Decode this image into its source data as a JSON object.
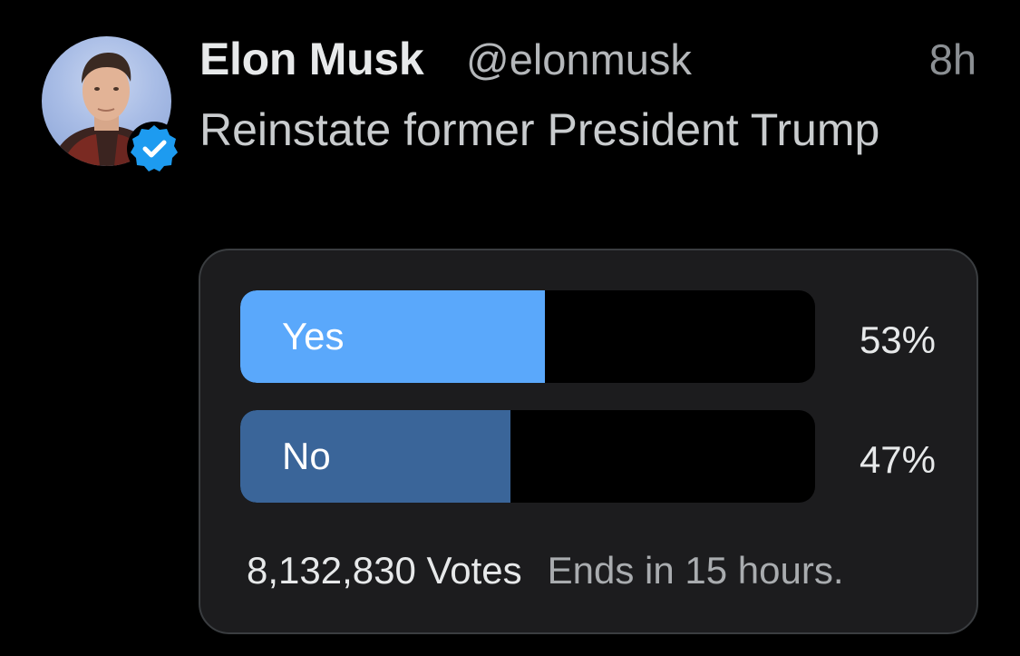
{
  "tweet": {
    "author_name": "Elon Musk",
    "author_handle": "@elonmusk",
    "timestamp": "8h",
    "text": "Reinstate former President Trump",
    "avatar_icon": "profile-photo",
    "verified_icon": "verified-check-icon",
    "verified_color": "#1d9bf0"
  },
  "poll": {
    "options": [
      {
        "label": "Yes",
        "percent_text": "53%",
        "fraction": 0.53,
        "color": "#5aa8fb"
      },
      {
        "label": "No",
        "percent_text": "47%",
        "fraction": 0.47,
        "color": "#3a6599"
      }
    ],
    "votes_text": "8,132,830 Votes",
    "ends_text": "Ends in 15 hours."
  }
}
